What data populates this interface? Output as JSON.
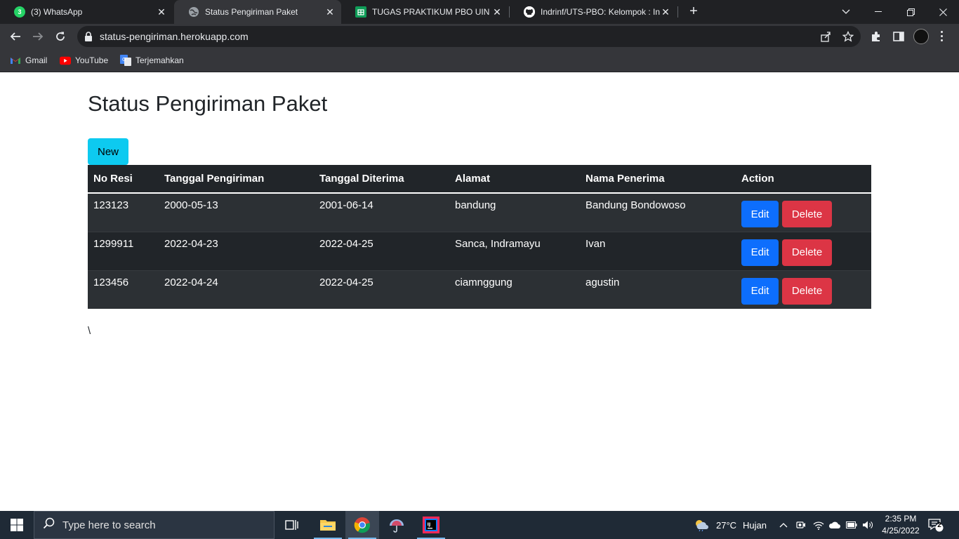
{
  "browser": {
    "tabs": [
      {
        "title": "(3) WhatsApp",
        "icon": "whatsapp-icon"
      },
      {
        "title": "Status Pengiriman Paket",
        "icon": "globe-icon"
      },
      {
        "title": "TUGAS PRAKTIKUM PBO UIN SGD",
        "icon": "google-sheets-icon"
      },
      {
        "title": "Indrinf/UTS-PBO: Kelompok : Indrinf",
        "icon": "github-icon"
      }
    ],
    "whatsapp_badge": "3",
    "url": "status-pengiriman.herokuapp.com",
    "bookmarks": [
      {
        "label": "Gmail",
        "icon": "gmail-icon"
      },
      {
        "label": "YouTube",
        "icon": "youtube-icon"
      },
      {
        "label": "Terjemahkan",
        "icon": "google-translate-icon"
      }
    ]
  },
  "page": {
    "title": "Status Pengiriman Paket",
    "new_button": "New",
    "stray_text": "\\",
    "table": {
      "headers": [
        "No Resi",
        "Tanggal Pengiriman",
        "Tanggal Diterima",
        "Alamat",
        "Nama Penerima",
        "Action"
      ],
      "rows": [
        {
          "no_resi": "123123",
          "tgl_kirim": "2000-05-13",
          "tgl_terima": "2001-06-14",
          "alamat": "bandung",
          "penerima": "Bandung Bondowoso"
        },
        {
          "no_resi": "1299911",
          "tgl_kirim": "2022-04-23",
          "tgl_terima": "2022-04-25",
          "alamat": "Sanca, Indramayu",
          "penerima": "Ivan"
        },
        {
          "no_resi": "123456",
          "tgl_kirim": "2022-04-24",
          "tgl_terima": "2022-04-25",
          "alamat": "ciamnggung",
          "penerima": "agustin"
        }
      ],
      "edit_label": "Edit",
      "delete_label": "Delete"
    }
  },
  "taskbar": {
    "search_placeholder": "Type here to search",
    "weather_temp": "27°C",
    "weather_desc": "Hujan",
    "time": "2:35 PM",
    "date": "4/25/2022",
    "notification_count": "2"
  },
  "colors": {
    "new_button": "#0dcaf0",
    "edit_button": "#0d6efd",
    "delete_button": "#dc3545",
    "table_bg": "#212529"
  }
}
